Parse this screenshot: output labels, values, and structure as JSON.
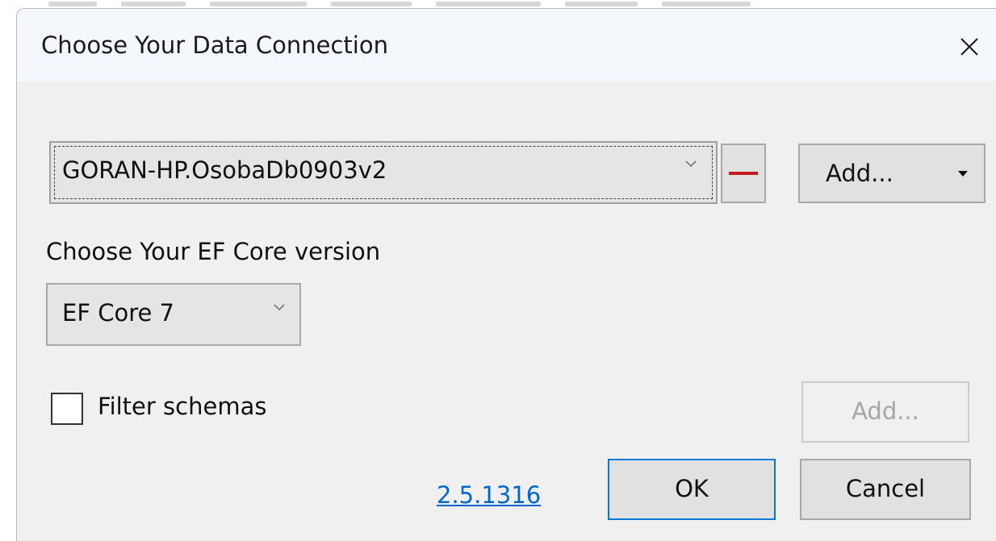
{
  "window": {
    "title": "Choose Your Data Connection",
    "close_icon": "close-icon"
  },
  "connection": {
    "selected": "GORAN-HP.OsobaDb0903v2",
    "remove_icon": "minus-icon",
    "remove_color": "#c41b20",
    "add_label": "Add..."
  },
  "ef_core": {
    "label": "Choose Your EF Core version",
    "selected": "EF Core 7"
  },
  "schemas": {
    "filter_label": "Filter schemas",
    "filter_checked": false,
    "add_label": "Add..."
  },
  "footer": {
    "version": "2.5.1316",
    "ok_label": "OK",
    "cancel_label": "Cancel"
  },
  "colors": {
    "accent": "#0078d7",
    "link": "#0066cc",
    "dialog_bg": "#f0f0f0",
    "titlebar_bg": "#f4f7fb"
  }
}
